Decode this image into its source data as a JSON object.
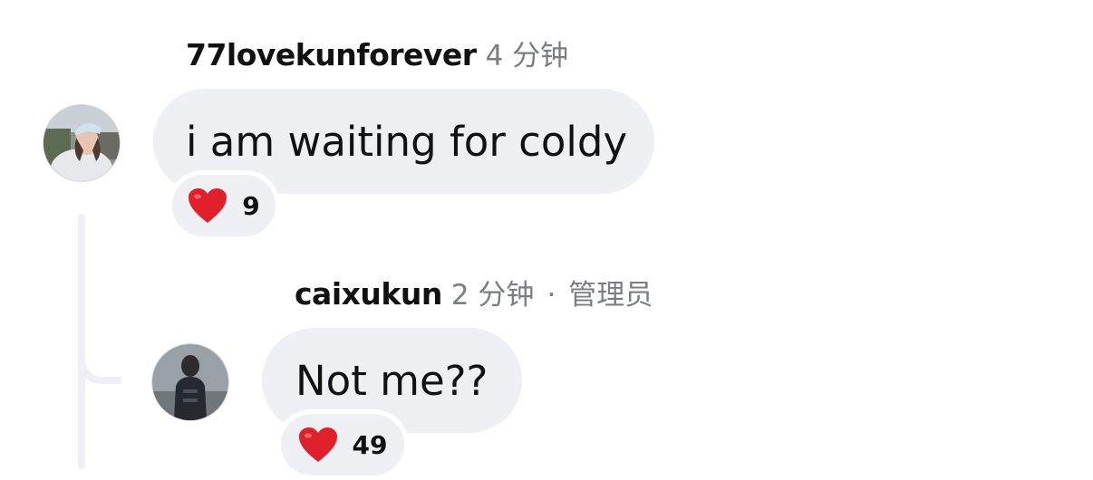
{
  "comments": [
    {
      "username": "77lovekunforever",
      "time": "4 分钟",
      "text": "i am waiting for coldy",
      "reaction_count": "9"
    },
    {
      "username": "caixukun",
      "time": "2 分钟",
      "separator": "·",
      "role": "管理员",
      "text": "Not me??",
      "reaction_count": "49"
    }
  ],
  "colors": {
    "bubble": "#eef0f4",
    "thread_line": "#eef0f3",
    "heart": "#e0202a",
    "meta_gray": "#7a7d82"
  },
  "icons": {
    "reaction": "red-heart-icon"
  }
}
